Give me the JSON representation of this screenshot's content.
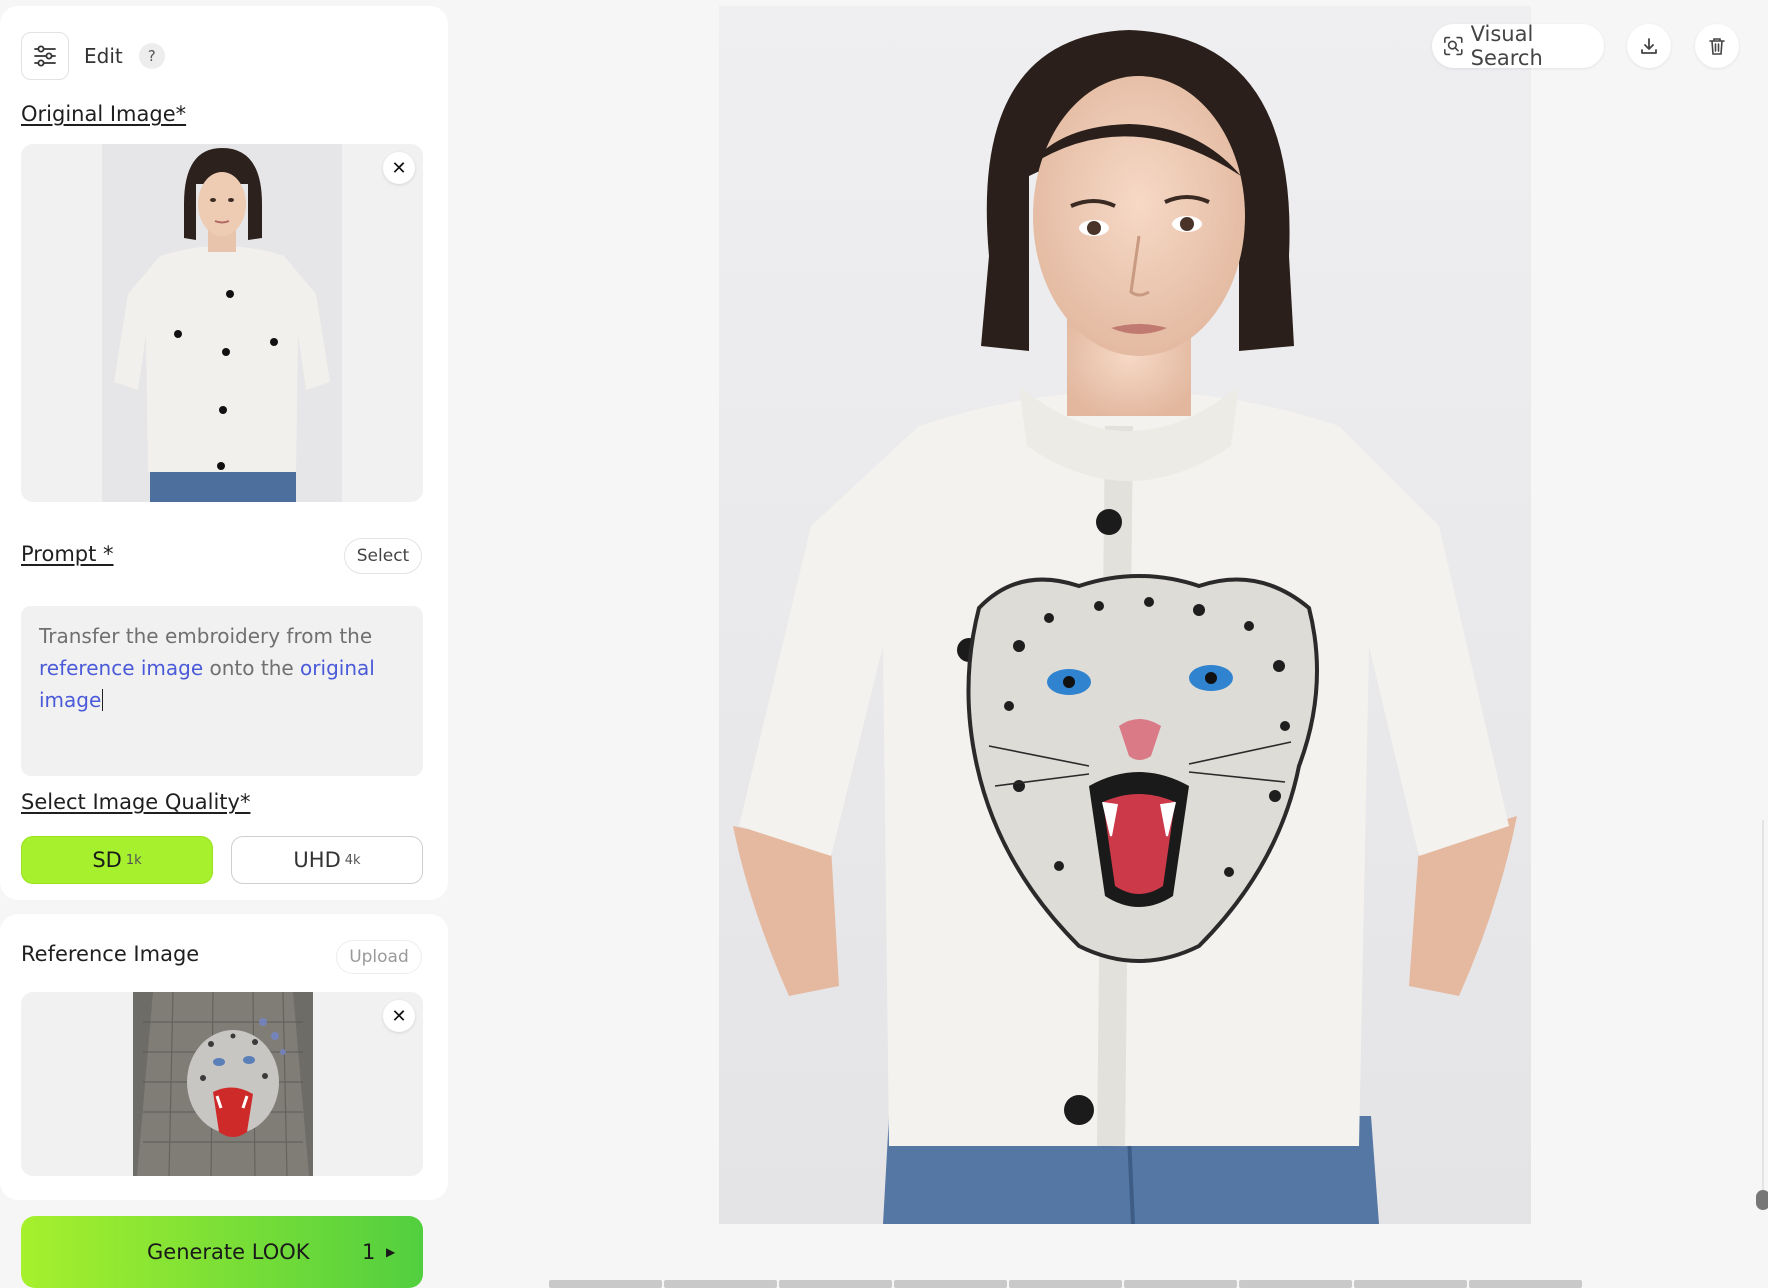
{
  "edit": {
    "label": "Edit",
    "help": "?"
  },
  "original_image": {
    "label": "Original Image*",
    "close": "✕"
  },
  "prompt": {
    "label": "Prompt *",
    "select_label": "Select",
    "text_1": "Transfer the embroidery from the ",
    "link_1": "reference image",
    "text_2": " onto the ",
    "link_2": "original image"
  },
  "quality": {
    "label": "Select Image Quality*",
    "options": [
      {
        "name": "SD",
        "sub": "1k",
        "selected": true
      },
      {
        "name": "UHD",
        "sub": "4k",
        "selected": false
      }
    ]
  },
  "reference": {
    "title": "Reference Image",
    "upload_label": "Upload",
    "close": "✕"
  },
  "generate": {
    "label": "Generate LOOK",
    "count": "1"
  },
  "toolbar": {
    "visual_search": "Visual Search"
  },
  "colors": {
    "accent": "#a6f02d",
    "link": "#4a5ad8",
    "generate_end": "#52cf3f"
  },
  "icons": [
    "sliders-icon",
    "question-icon",
    "close-icon",
    "visual-search-icon",
    "download-icon",
    "trash-icon",
    "caret-right-icon"
  ]
}
